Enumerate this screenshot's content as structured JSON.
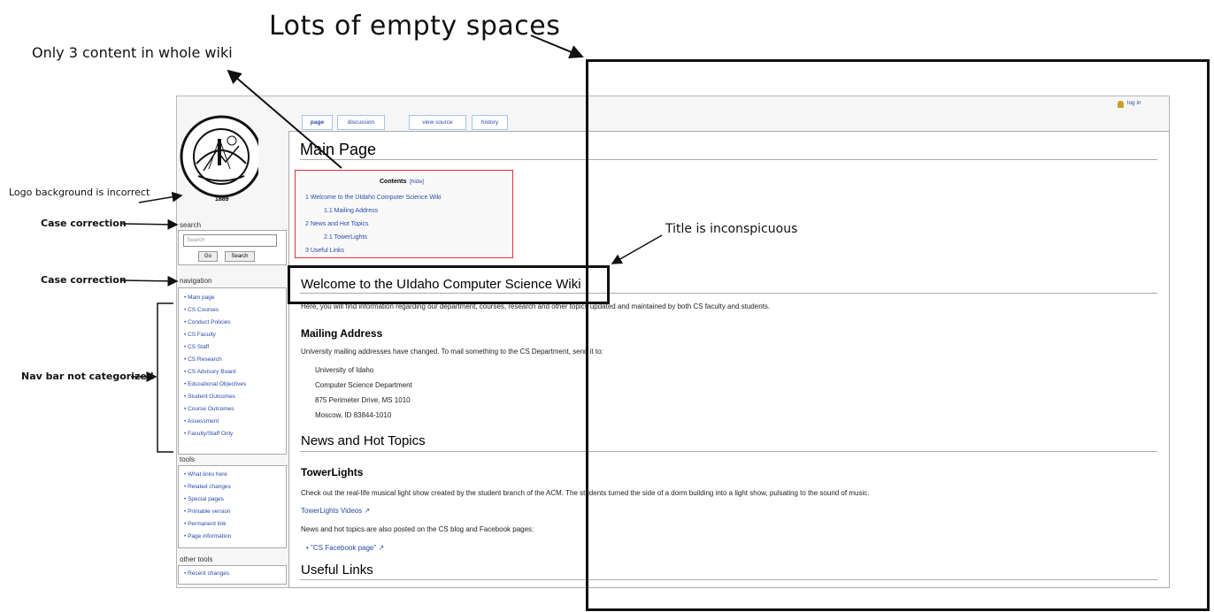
{
  "annotations": {
    "empty_spaces": "Lots of empty spaces",
    "only_content": "Only 3 content in whole wiki",
    "logo_bg": "Logo background is incorrect",
    "case_search": "Case correction",
    "case_nav": "Case correction",
    "nav_uncategorized": "Nav bar not categorized",
    "title": "Title is inconspicuous"
  },
  "wiki": {
    "logo_text": "THE UNIVERSITY OF IDAHO",
    "logo_year": "1889",
    "login": "log in",
    "tabs": [
      "page",
      "discussion",
      "view source",
      "history"
    ],
    "search": {
      "heading": "search",
      "placeholder": "Search",
      "go": "Go",
      "search_btn": "Search"
    },
    "navigation": {
      "heading": "navigation",
      "items": [
        "Main page",
        "CS Courses",
        "Conduct Policies",
        "CS Faculty",
        "CS Staff",
        "CS Research",
        "CS Advisory Board",
        "Educational Objectives",
        "Student Outcomes",
        "Course Outcomes",
        "Assessment",
        "Faculty/Staff Only"
      ]
    },
    "tools": {
      "heading": "tools",
      "items": [
        "What links here",
        "Related changes",
        "Special pages",
        "Printable version",
        "Permanent link",
        "Page information"
      ]
    },
    "other_tools": {
      "heading": "other tools",
      "items": [
        "Recent changes"
      ]
    },
    "page_title": "Main Page",
    "toc": {
      "title": "Contents",
      "hide": "[hide]",
      "items": [
        "1 Welcome to the UIdaho Computer Science Wiki",
        "1.1 Mailing Address",
        "2 News and Hot Topics",
        "2.1 TowerLights",
        "3 Useful Links"
      ]
    },
    "welcome_heading": "Welcome to the UIdaho Computer Science Wiki",
    "welcome_text": "Here, you will find information regarding our department, courses, research and other topics updated and maintained by both CS faculty and students.",
    "mailing_heading": "Mailing Address",
    "mailing_text": "University mailing addresses have changed. To mail something to the CS Department, send it to:",
    "address": [
      "University of Idaho",
      "Computer Science Department",
      "875 Perimeter Drive, MS 1010",
      "Moscow, ID 83844-1010"
    ],
    "news_heading": "News and Hot Topics",
    "towerlights_heading": "TowerLights",
    "towerlights_text": "Check out the real-life musical light show created by the student branch of the ACM. The students turned the side of a dorm building into a light show, pulsating to the sound of music.",
    "towerlights_link": "TowerLights Videos",
    "news_text": "News and hot topics are also posted on the CS blog and Facebook pages:",
    "facebook_link": "\"CS Facebook page\"",
    "useful_heading": "Useful Links"
  }
}
